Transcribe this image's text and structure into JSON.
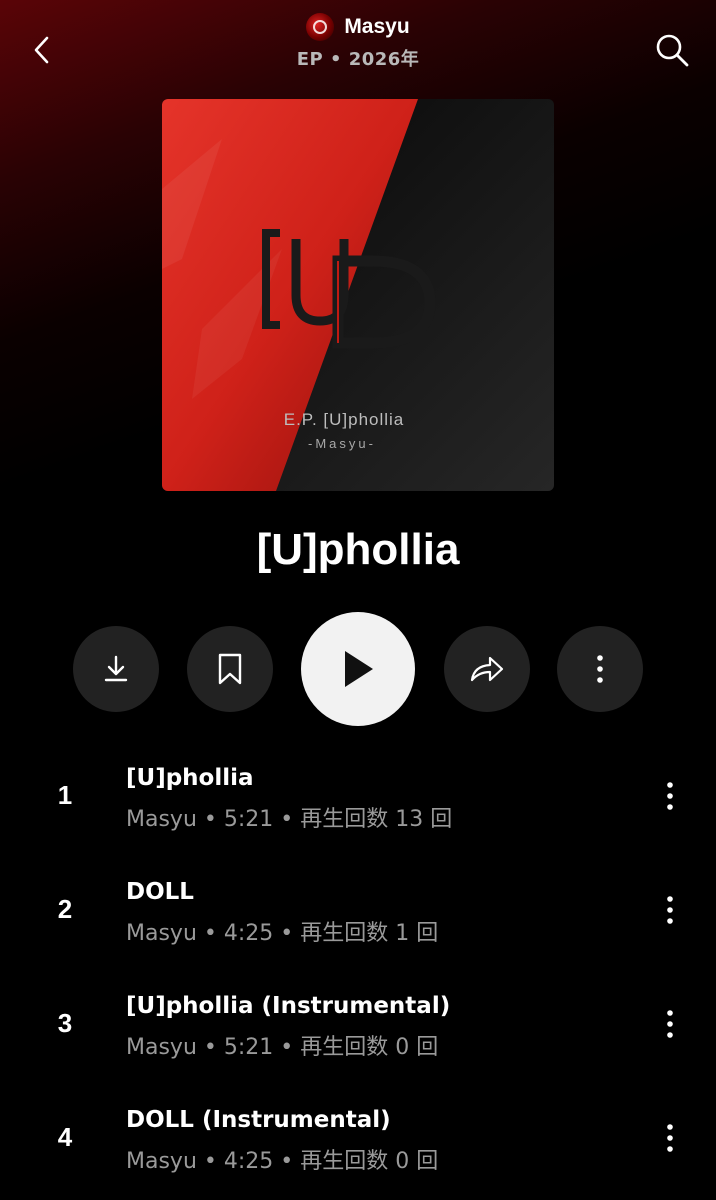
{
  "header": {
    "artist": "Masyu",
    "subtitle": "EP • 2026年"
  },
  "cover": {
    "logo_text": "[U]D",
    "line1": "E.P. [U]phollia",
    "line2": "-Masyu-",
    "accent_color": "#d8241c"
  },
  "album": {
    "title": "[U]phollia"
  },
  "actions": {
    "download": "download-icon",
    "save": "bookmark-icon",
    "play": "play-icon",
    "share": "share-icon",
    "more": "more-vertical-icon"
  },
  "tracks": [
    {
      "num": "1",
      "title": "[U]phollia",
      "meta": "Masyu • 5:21 • 再生回数 13 回"
    },
    {
      "num": "2",
      "title": "DOLL",
      "meta": "Masyu • 4:25 • 再生回数 1 回"
    },
    {
      "num": "3",
      "title": "[U]phollia (Instrumental)",
      "meta": "Masyu • 5:21 • 再生回数 0 回"
    },
    {
      "num": "4",
      "title": "DOLL (Instrumental)",
      "meta": "Masyu • 4:25 • 再生回数 0 回"
    }
  ]
}
